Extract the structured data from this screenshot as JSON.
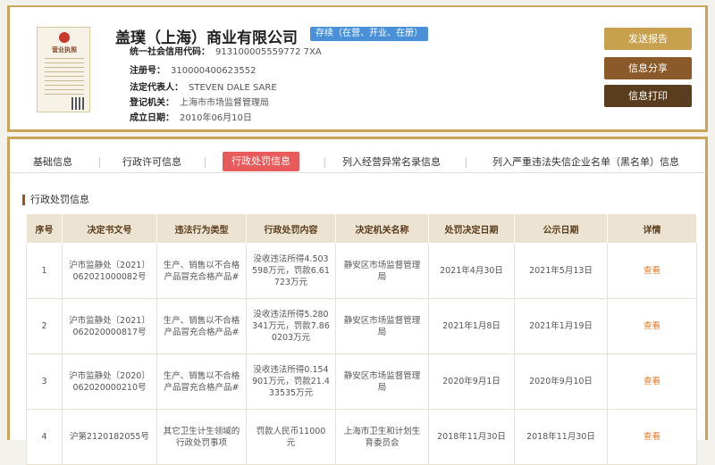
{
  "company": {
    "name": "盖璞（上海）商业有限公司",
    "status": "存续（在营、开业、在册）",
    "license_title": "营业执照",
    "fields": [
      {
        "label": "统一社会信用代码：",
        "value": "913100005559772 7XA"
      },
      {
        "label": "注册号：",
        "value": "310000400623552"
      },
      {
        "label": "法定代表人：",
        "value": "STEVEN DALE SARE"
      },
      {
        "label": "登记机关：",
        "value": "上海市市场监督管理局"
      },
      {
        "label": "成立日期：",
        "value": "2010年06月10日"
      }
    ]
  },
  "actions": {
    "report": "发送报告",
    "share": "信息分享",
    "print": "信息打印"
  },
  "tabs": [
    {
      "label": "基础信息",
      "active": false
    },
    {
      "label": "行政许可信息",
      "active": false
    },
    {
      "label": "行政处罚信息",
      "active": true
    },
    {
      "label": "列入经营异常名录信息",
      "active": false
    },
    {
      "label": "列入严重违法失信企业名单（黑名单）信息",
      "active": false
    }
  ],
  "section_title": "行政处罚信息",
  "table": {
    "headers": [
      "序号",
      "决定书文号",
      "违法行为类型",
      "行政处罚内容",
      "决定机关名称",
      "处罚决定日期",
      "公示日期",
      "详情"
    ],
    "rows": [
      [
        "1",
        "沪市监静处〔2021〕062021000082号",
        "生产、销售以不合格产品冒充合格产品#",
        "没收违法所得4.503598万元，罚款6.61723万元",
        "静安区市场监督管理局",
        "2021年4月30日",
        "2021年5月13日",
        "查看"
      ],
      [
        "2",
        "沪市监静处〔2021〕062020000817号",
        "生产、销售以不合格产品冒充合格产品#",
        "没收违法所得5.280341万元，罚款7.860203万元",
        "静安区市场监督管理局",
        "2021年1月8日",
        "2021年1月19日",
        "查看"
      ],
      [
        "3",
        "沪市监静处〔2020〕062020000210号",
        "生产、销售以不合格产品冒充合格产品#",
        "没收违法所得0.154901万元，罚款21.433535万元",
        "静安区市场监督管理局",
        "2020年9月1日",
        "2020年9月10日",
        "查看"
      ],
      [
        "4",
        "沪第2120182055号",
        "其它卫生计生领域的行政处罚事项",
        "罚款人民币11000元",
        "上海市卫生和计划生育委员会",
        "2018年11月30日",
        "2018年11月30日",
        "查看"
      ]
    ]
  },
  "colors": {
    "accent_gold": "#c9a55c",
    "active_tab": "#e85b5b",
    "status_badge": "#4a90d9",
    "link": "#e07a2e"
  }
}
